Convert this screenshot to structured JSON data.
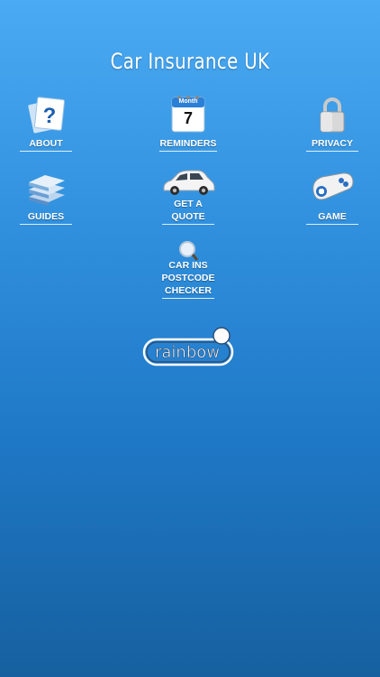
{
  "app": {
    "title": "Car Insurance UK"
  },
  "menu": {
    "about": "ABOUT",
    "reminders": "REMINDERS",
    "reminders_month": "Month",
    "reminders_day": "7",
    "privacy": "PRIVACY",
    "guides": "GUIDES",
    "quote": "GET A\nQUOTE",
    "game": "GAME",
    "postcode": "CAR INS\nPOSTCODE\nCHECKER"
  },
  "logo": {
    "text": "rainbow"
  }
}
